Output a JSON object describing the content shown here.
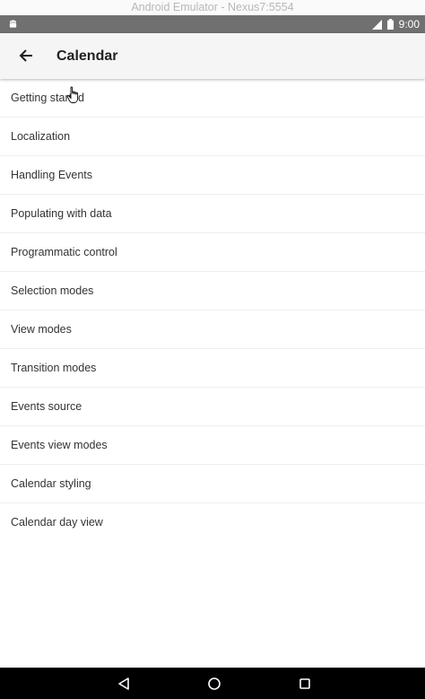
{
  "emulator": {
    "title": "Android Emulator - Nexus7:5554"
  },
  "status_bar": {
    "time": "9:00",
    "icons": [
      "android-icon",
      "signal-icon",
      "battery-icon"
    ]
  },
  "app_bar": {
    "title": "Calendar",
    "back_icon": "arrow-back-icon"
  },
  "list": {
    "items": [
      {
        "label": "Getting started"
      },
      {
        "label": "Localization"
      },
      {
        "label": "Handling Events"
      },
      {
        "label": "Populating with data"
      },
      {
        "label": "Programmatic control"
      },
      {
        "label": "Selection modes"
      },
      {
        "label": "View modes"
      },
      {
        "label": "Transition modes"
      },
      {
        "label": "Events source"
      },
      {
        "label": "Events view modes"
      },
      {
        "label": "Calendar styling"
      },
      {
        "label": "Calendar day view"
      }
    ]
  },
  "nav_bar": {
    "icons": [
      "nav-back-icon",
      "nav-home-icon",
      "nav-recents-icon"
    ]
  },
  "colors": {
    "status_bar": "#707070",
    "app_bar": "#f5f5f5",
    "nav_bar": "#000000",
    "text": "#333333"
  }
}
